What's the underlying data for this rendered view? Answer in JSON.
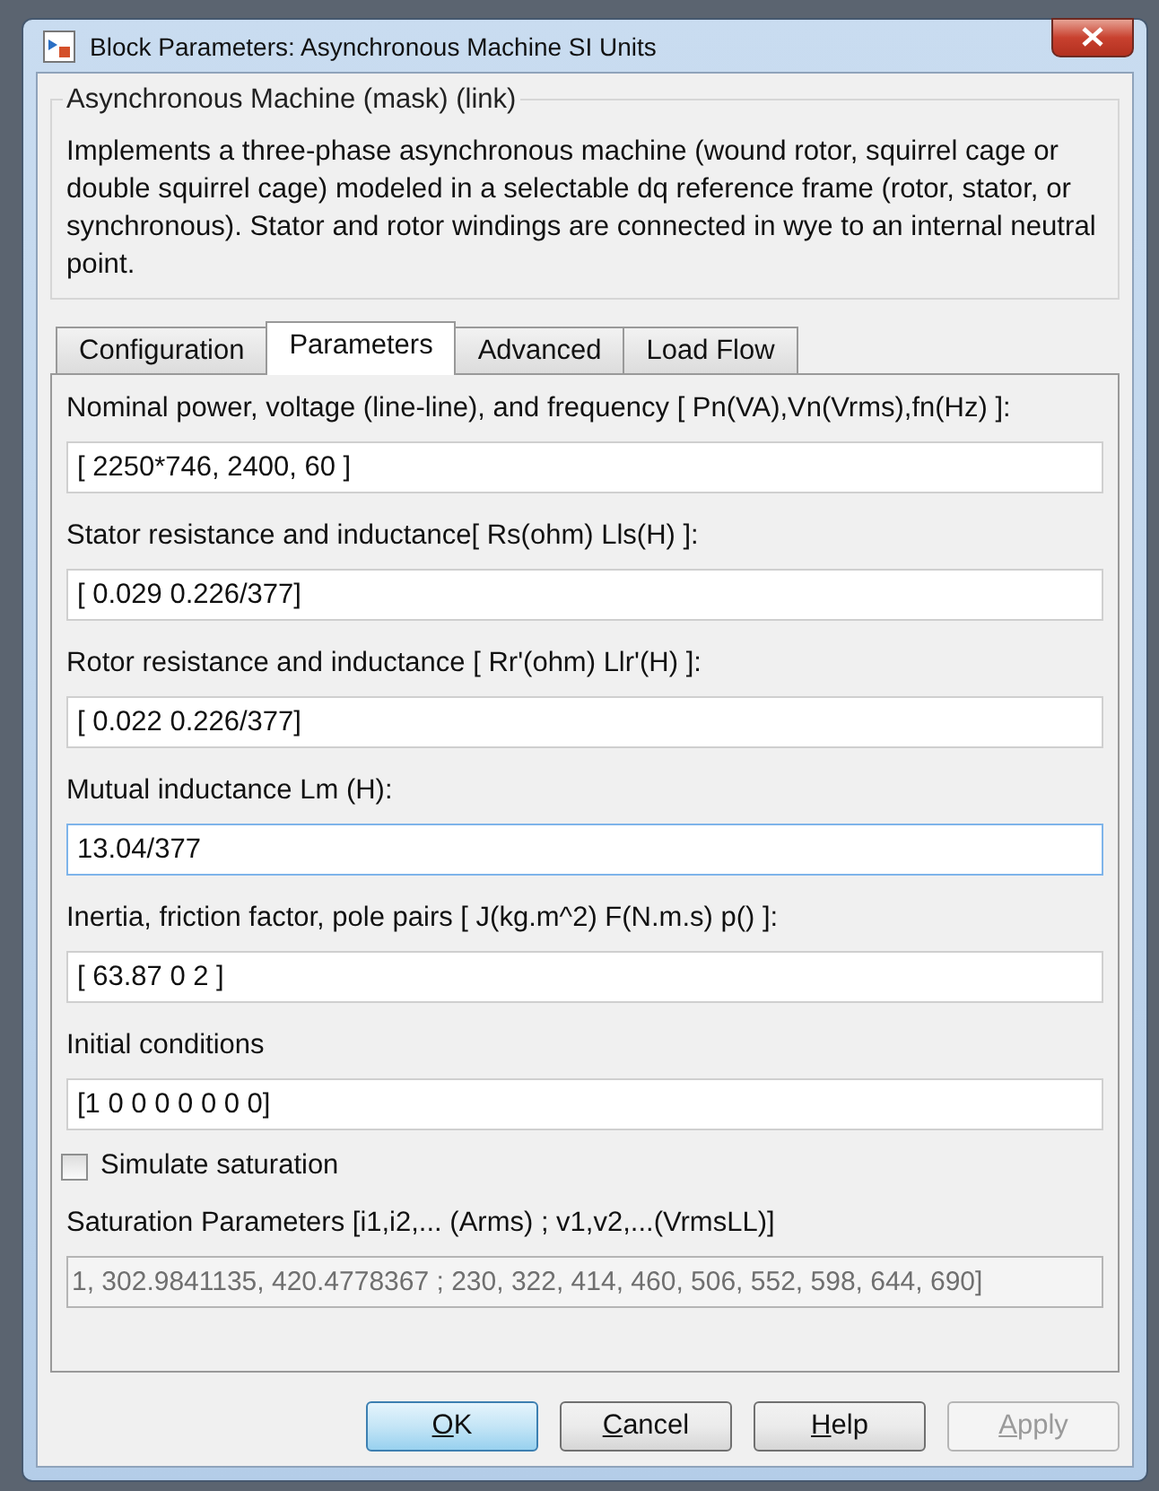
{
  "window": {
    "title": "Block Parameters: Asynchronous Machine SI Units"
  },
  "description": {
    "heading": "Asynchronous Machine (mask) (link)",
    "text": "Implements a three-phase asynchronous machine (wound rotor, squirrel cage or double squirrel cage) modeled in a selectable dq reference frame (rotor, stator, or synchronous). Stator and rotor windings are connected in wye to an internal neutral point."
  },
  "tabs": [
    {
      "label": "Configuration",
      "selected": false
    },
    {
      "label": "Parameters",
      "selected": true
    },
    {
      "label": "Advanced",
      "selected": false
    },
    {
      "label": "Load Flow",
      "selected": false
    }
  ],
  "parameters": [
    {
      "kind": "field",
      "label": "Nominal power, voltage (line-line), and frequency [ Pn(VA),Vn(Vrms),fn(Hz) ]:",
      "value": "[ 2250*746, 2400, 60 ]",
      "focused": false,
      "disabled": false
    },
    {
      "kind": "field",
      "label": "Stator resistance and inductance[ Rs(ohm)  Lls(H) ]:",
      "value": "[ 0.029 0.226/377]",
      "focused": false,
      "disabled": false
    },
    {
      "kind": "field",
      "label": "Rotor resistance and inductance [ Rr'(ohm)  Llr'(H) ]:",
      "value": "[ 0.022 0.226/377]",
      "focused": false,
      "disabled": false
    },
    {
      "kind": "field",
      "label": "Mutual inductance Lm (H):",
      "value": "13.04/377",
      "focused": true,
      "disabled": false
    },
    {
      "kind": "field",
      "label": "Inertia, friction factor, pole pairs [ J(kg.m^2)  F(N.m.s)   p() ]:",
      "value": "[ 63.87 0  2 ]",
      "focused": false,
      "disabled": false
    },
    {
      "kind": "field",
      "label": "Initial conditions",
      "value": "[1 0 0 0 0 0 0 0]",
      "focused": false,
      "disabled": false
    },
    {
      "kind": "checkbox",
      "label": "Simulate saturation",
      "checked": false
    },
    {
      "kind": "field",
      "label": "Saturation Parameters [i1,i2,... (Arms) ; v1,v2,...(VrmsLL)]",
      "value": "1, 302.9841135, 420.4778367 ; 230, 322, 414, 460, 506, 552, 598, 644, 690]",
      "focused": false,
      "disabled": true
    }
  ],
  "buttons": [
    {
      "label": "OK",
      "default": true,
      "disabled": false
    },
    {
      "label": "Cancel",
      "default": false,
      "disabled": false
    },
    {
      "label": "Help",
      "default": false,
      "disabled": false
    },
    {
      "label": "Apply",
      "default": false,
      "disabled": true
    }
  ]
}
